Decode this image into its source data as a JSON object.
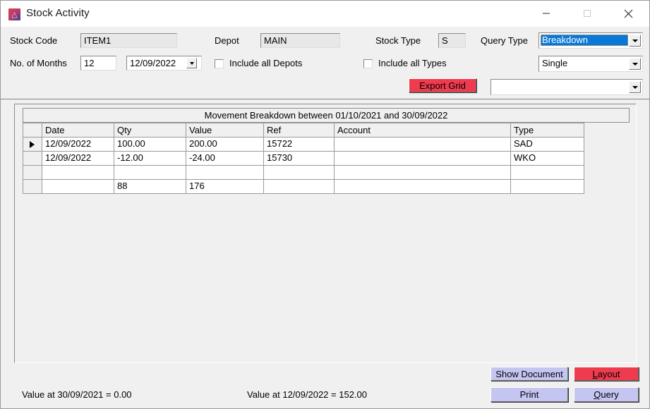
{
  "window": {
    "title": "Stock Activity",
    "icon": "app-logo-icon",
    "minimize": "minimize-icon",
    "maximize": "maximize-icon",
    "close": "close-icon"
  },
  "form": {
    "stock_code_label": "Stock Code",
    "stock_code_value": "ITEM1",
    "months_label": "No. of Months",
    "months_value": "12",
    "date_value": "12/09/2022",
    "depot_label": "Depot",
    "depot_value": "MAIN",
    "include_all_depots_label": "Include all Depots",
    "include_all_depots_checked": false,
    "stock_type_label": "Stock Type",
    "stock_type_value": "S",
    "include_all_types_label": "Include all Types",
    "include_all_types_checked": false,
    "query_type_label": "Query Type",
    "query_type_value": "Breakdown",
    "query_type_selected": true,
    "scope_value": "Single",
    "extra_value": "",
    "export_grid_label": "Export Grid"
  },
  "grid": {
    "title": "Movement Breakdown between 01/10/2021 and 30/09/2022",
    "columns": [
      "",
      "Date",
      "Qty",
      "Value",
      "Ref",
      "Account",
      "Type"
    ],
    "rows": [
      {
        "selected": true,
        "cells": [
          "12/09/2022",
          "100.00",
          "200.00",
          "15722",
          "",
          "SAD"
        ]
      },
      {
        "selected": false,
        "cells": [
          "12/09/2022",
          "-12.00",
          "-24.00",
          "15730",
          "",
          "WKO"
        ]
      },
      {
        "selected": false,
        "cells": [
          "",
          "",
          "",
          "",
          "",
          ""
        ]
      },
      {
        "selected": false,
        "cells": [
          "",
          "88",
          "176",
          "",
          "",
          ""
        ]
      }
    ]
  },
  "footer": {
    "value_opening": "Value at 30/09/2021 = 0.00",
    "value_closing": "Value at 12/09/2022 = 152.00",
    "show_document_label": "Show Document",
    "layout_label_pre": "",
    "layout_label_accel": "L",
    "layout_label_post": "ayout",
    "print_label": "Print",
    "query_label_pre": "",
    "query_label_accel": "Q",
    "query_label_post": "uery"
  },
  "colors": {
    "accent_red": "#ef3b4e",
    "accent_lavender": "#c5c5f2",
    "selection_blue": "#0a78d7",
    "panel_gray": "#f0f0f0"
  }
}
